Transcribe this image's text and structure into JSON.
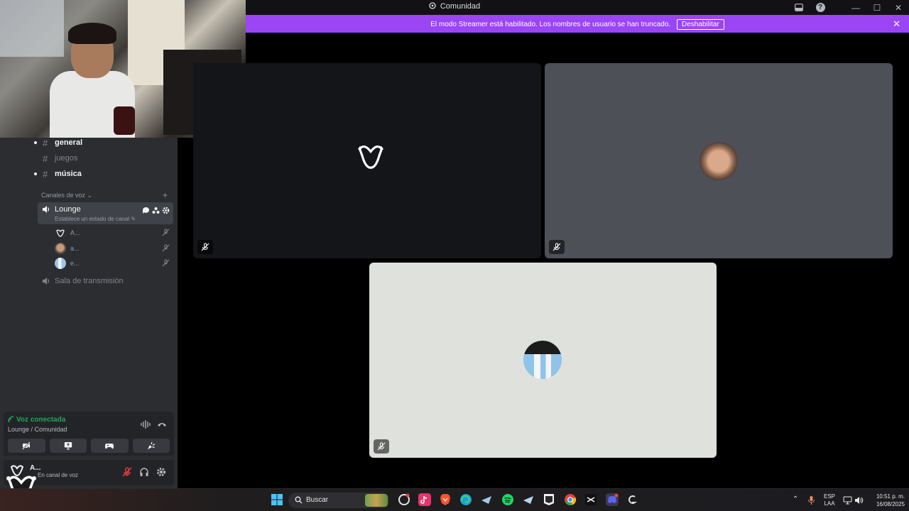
{
  "window": {
    "title": "Comunidad",
    "controls": {
      "minimize": "—",
      "maximize": "☐",
      "close": "✕"
    }
  },
  "banner": {
    "message": "El modo Streamer está habilitado. Los nombres de usuario se han truncado.",
    "button_label": "Deshabilitar",
    "close": "✕",
    "color": "#9b45f4"
  },
  "sidebar": {
    "text_channels": [
      {
        "name": "general",
        "unread": true
      },
      {
        "name": "juegos",
        "unread": false
      },
      {
        "name": "música",
        "unread": true
      }
    ],
    "hash_symbol": "#",
    "voice_category": "Canales de voz ⌄",
    "add_symbol": "+",
    "active_voice_channel": {
      "name": "Lounge",
      "status_placeholder": "Establece un estado de canal ✎"
    },
    "voice_users": [
      {
        "name": "A..."
      },
      {
        "name": "a..."
      },
      {
        "name": "e..."
      }
    ],
    "stage_channel": "Sala de transmisión"
  },
  "voice_panel": {
    "status": "Voz conectada",
    "location": "Lounge / Comunidad",
    "status_color": "#23a55a"
  },
  "user_bar": {
    "name": "A...",
    "status": "En canal de voz"
  },
  "video_tiles": [
    {
      "bg": "#141519",
      "avatar": "jester-logo"
    },
    {
      "bg": "#4e5058",
      "avatar": "face-photo"
    },
    {
      "bg": "#dfe1dd",
      "avatar": "striped-jersey-photo"
    }
  ],
  "taskbar": {
    "search_label": "Buscar",
    "language_top": "ESP",
    "language_bottom": "LAA",
    "time": "10:51 p. m.",
    "date": "16/08/2025",
    "chevron": "⌃"
  }
}
